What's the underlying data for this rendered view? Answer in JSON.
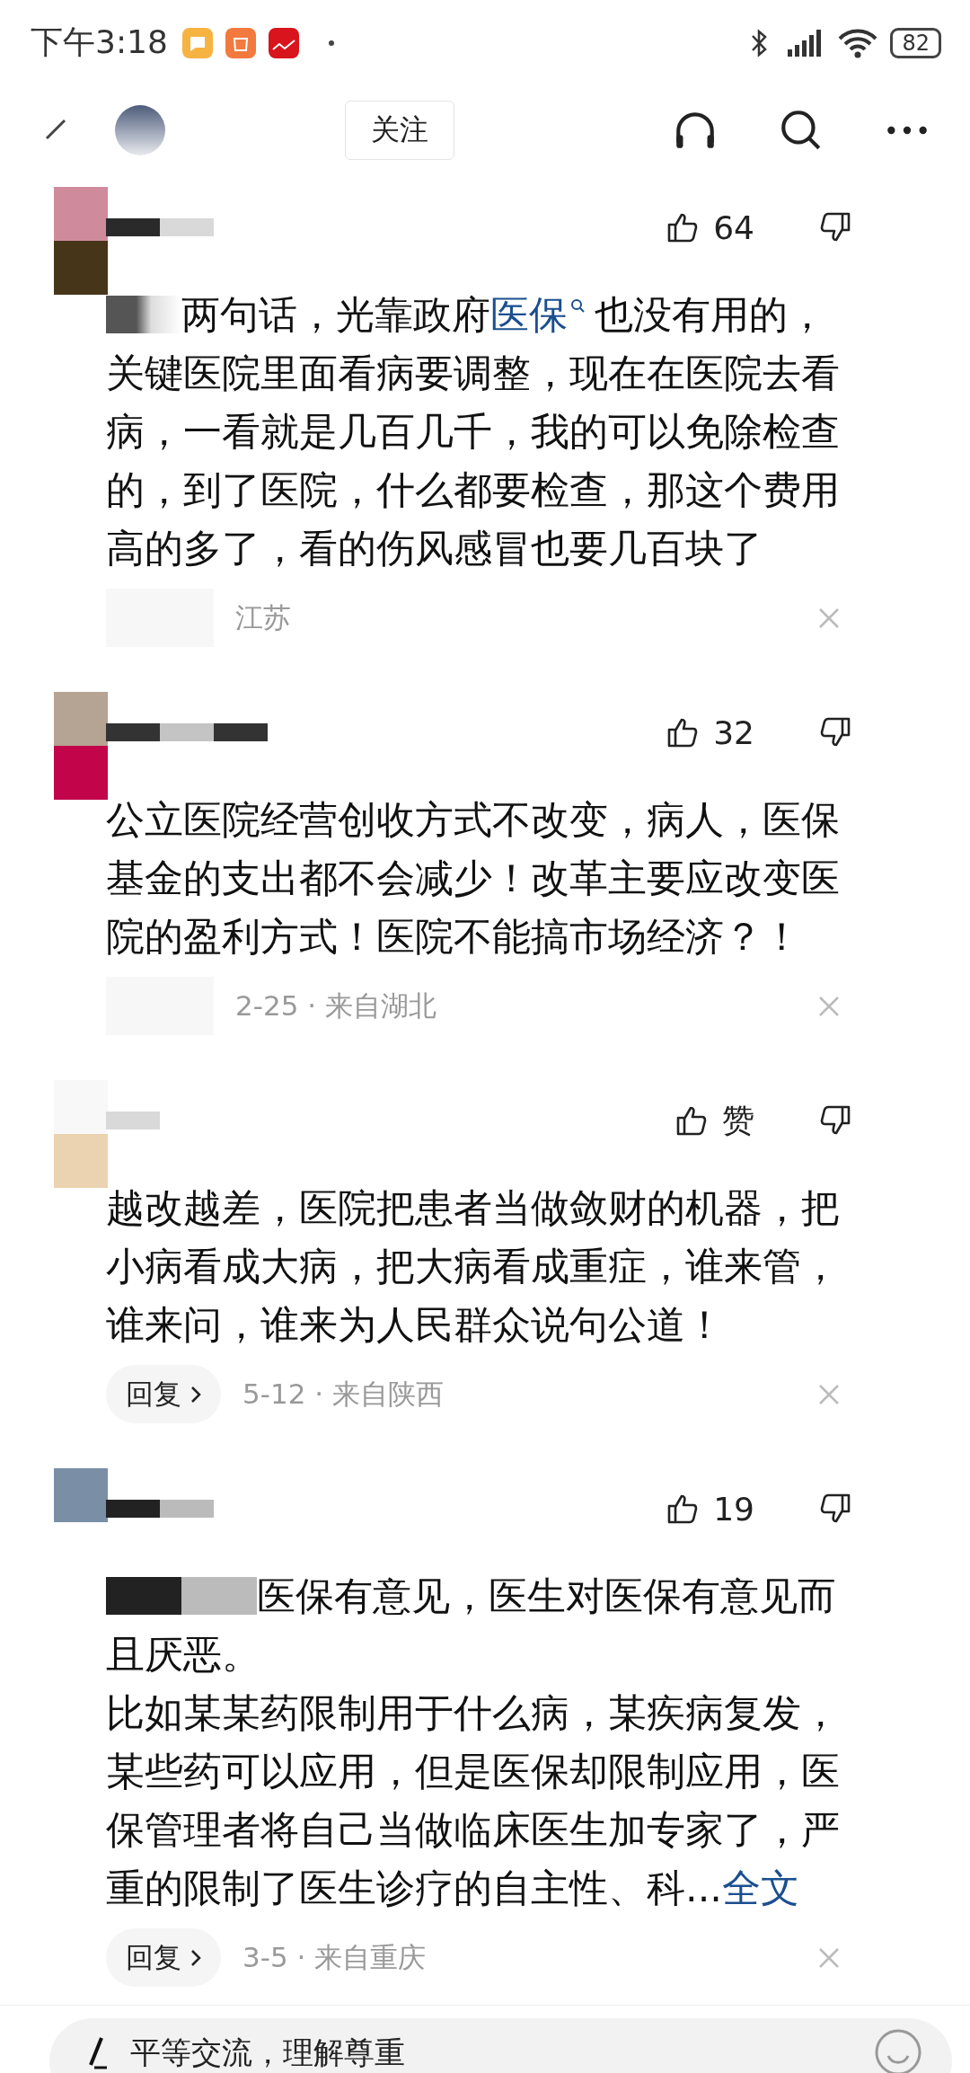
{
  "status_bar": {
    "time": "下午3:18",
    "battery": "82"
  },
  "header": {
    "follow_button": "关注"
  },
  "comments": [
    {
      "likes": "64",
      "body": [
        {
          "kind": "text",
          "text": "两句话，光靠政府"
        },
        {
          "kind": "search_link",
          "text": "医保"
        },
        {
          "kind": "text",
          "text": "也没有用的，关键医院里面看病要调整，现在在医院去看病，一看就是几百几千，我的可以免除检查的，到了医院，什么都要检查，那这个费用高的多了，看的伤风感冒也要几百块了"
        }
      ],
      "meta": "江苏"
    },
    {
      "likes": "32",
      "body": [
        {
          "kind": "text",
          "text": "公立医院经营创收方式不改变，病人，医保基金的支出都不会减少！改革主要应改变医院的盈利方式！医院不能搞市场经济？！"
        }
      ],
      "meta": "2-25 · 来自湖北"
    },
    {
      "likes": "赞",
      "reply": "回复",
      "body": [
        {
          "kind": "text",
          "text": "越改越差，医院把患者当做敛财的机器，把小病看成大病，把大病看成重症，谁来管，谁来问，谁来为人民群众说句公道！"
        }
      ],
      "meta": "5-12 · 来自陕西"
    },
    {
      "likes": "19",
      "reply": "回复",
      "body": [
        {
          "kind": "text",
          "text": "医保有意见，医生对医保有意见而且厌恶。"
        },
        {
          "kind": "break"
        },
        {
          "kind": "text",
          "text": "比如某某药限制用于什么病，某疾病复发，某些药可以应用，但是医保却限制应用，医保管理者将自己当做临床医生加专家了，严重的限制了医生诊疗的自主性、科..."
        },
        {
          "kind": "link",
          "text": "全文"
        }
      ],
      "meta": "3-5 · 来自重庆"
    }
  ],
  "comment_input": {
    "placeholder": "平等交流，理解尊重"
  }
}
